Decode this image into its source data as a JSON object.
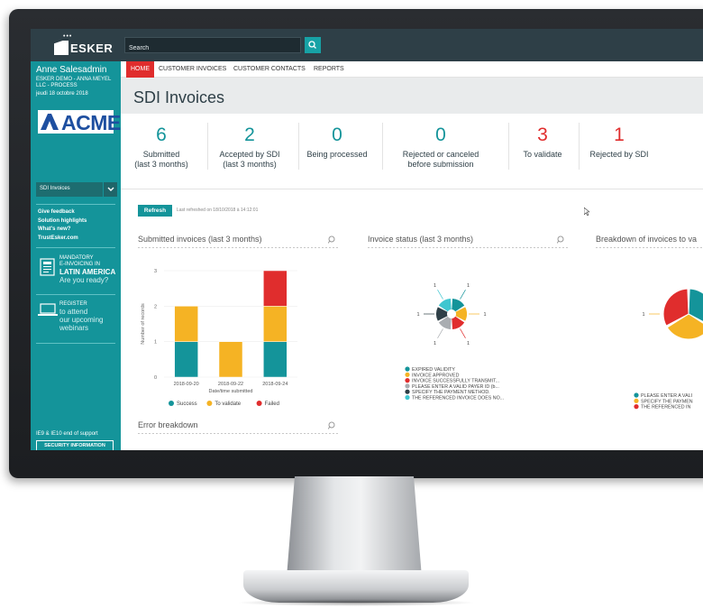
{
  "app": {
    "logo_text": "ESKER",
    "search_placeholder": "Search"
  },
  "user": {
    "name": "Anne Salesadmin",
    "org": "ESKER DEMO - ANNA MEYEL LLC - PROCESS",
    "date": "jeudi 18 octobre 2018"
  },
  "sidebar": {
    "brand_logo_text": "ACME",
    "select_value": "SDI Invoices",
    "links": [
      "Give feedback",
      "Solution highlights",
      "What's new?",
      "TrustEsker.com"
    ],
    "promo1": {
      "line1": "MANDATORY",
      "line2": "E-INVOICING IN",
      "line3": "LATIN AMERICA",
      "line4": "Are you ready?"
    },
    "promo2": {
      "line1": "REGISTER",
      "line2": "to attend",
      "line3": "our upcoming",
      "line4": "webinars"
    },
    "ie_note": "IE9 & IE10 end of support",
    "security_button": "SECURITY INFORMATION"
  },
  "nav": {
    "items": [
      "HOME",
      "CUSTOMER INVOICES",
      "CUSTOMER CONTACTS",
      "REPORTS"
    ]
  },
  "page": {
    "title": "SDI Invoices"
  },
  "stats": [
    {
      "value": "6",
      "label1": "Submitted",
      "label2": "(last 3 months)",
      "color": "#14949a"
    },
    {
      "value": "2",
      "label1": "Accepted by SDI",
      "label2": "(last 3 months)",
      "color": "#14949a"
    },
    {
      "value": "0",
      "label1": "Being processed",
      "label2": "",
      "color": "#14949a"
    },
    {
      "value": "0",
      "label1": "Rejected or canceled",
      "label2": "before submission",
      "color": "#14949a"
    },
    {
      "value": "3",
      "label1": "To validate",
      "label2": "",
      "color": "#e02d2d"
    },
    {
      "value": "1",
      "label1": "Rejected by SDI",
      "label2": "",
      "color": "#e02d2d"
    }
  ],
  "content": {
    "refresh_label": "Refresh",
    "refresh_note": "Last refreshed on 18/10/2018 à 14:12:01"
  },
  "panels": {
    "submitted_title": "Submitted invoices (last 3 months)",
    "status_title": "Invoice status (last 3 months)",
    "breakdown_title": "Breakdown of invoices to va",
    "error_title": "Error breakdown"
  },
  "chart_data": [
    {
      "type": "bar",
      "stacked": true,
      "categories": [
        "2018-09-20",
        "2018-09-22",
        "2018-09-24"
      ],
      "series": [
        {
          "name": "Success",
          "values": [
            1,
            0,
            1
          ],
          "color": "#14949a"
        },
        {
          "name": "To validate",
          "values": [
            1,
            1,
            1
          ],
          "color": "#f5b324"
        },
        {
          "name": "Failed",
          "values": [
            0,
            0,
            1
          ],
          "color": "#e02d2d"
        }
      ],
      "xlabel": "Date/time submitted",
      "ylabel": "Number of records",
      "yticks": [
        "0",
        "1",
        "2",
        "3"
      ],
      "ylim": [
        0,
        3
      ],
      "legend": "bottom"
    },
    {
      "type": "pie",
      "slices": [
        {
          "name": "EXPIRED VALIDITY",
          "value": 1,
          "color": "#14949a"
        },
        {
          "name": "INVOICE APPROVED",
          "value": 1,
          "color": "#f5b324"
        },
        {
          "name": "INVOICE SUCCESSFULLY TRANSMIT...",
          "value": 1,
          "color": "#e02d2d"
        },
        {
          "name": "PLEASE ENTER A VALID PAYER ID (b...",
          "value": 1,
          "color": "#a9adb1"
        },
        {
          "name": "SPECIFY THE PAYMENT METHOD.",
          "value": 1,
          "color": "#2e3f47"
        },
        {
          "name": "THE REFERENCED INVOICE DOES NO...",
          "value": 1,
          "color": "#3fc6d0"
        }
      ],
      "slice_labels": [
        "1",
        "1",
        "1",
        "1",
        "1",
        "1"
      ],
      "legend": "bottom-left"
    },
    {
      "type": "pie",
      "slices": [
        {
          "name": "PLEASE ENTER A VALI",
          "value": 1,
          "color": "#14949a"
        },
        {
          "name": "SPECIFY THE PAYMEN",
          "value": 1,
          "color": "#f5b324"
        },
        {
          "name": "THE REFERENCED IN",
          "value": 1,
          "color": "#e02d2d"
        }
      ],
      "slice_labels": [
        "1"
      ],
      "legend": "bottom-left"
    }
  ]
}
